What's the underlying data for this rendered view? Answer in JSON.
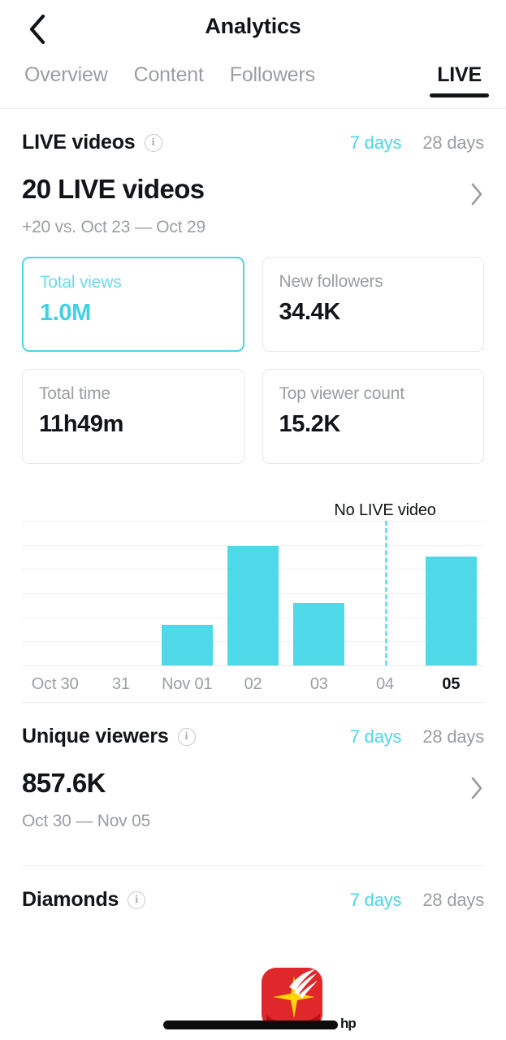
{
  "header": {
    "title": "Analytics",
    "back_icon": "chevron-left-icon"
  },
  "tabs": [
    {
      "label": "Overview",
      "active": false
    },
    {
      "label": "Content",
      "active": false
    },
    {
      "label": "Followers",
      "active": false
    },
    {
      "label": "LIVE",
      "active": true
    }
  ],
  "live_videos": {
    "title": "LIVE videos",
    "info_icon": "info-icon",
    "ranges": [
      {
        "label": "7 days",
        "active": true
      },
      {
        "label": "28 days",
        "active": false
      }
    ],
    "headline": "20 LIVE videos",
    "compare": "+20 vs. Oct 23 — Oct 29",
    "chevron_icon": "chevron-right-icon",
    "cards": [
      {
        "label": "Total views",
        "value": "1.0M",
        "selected": true
      },
      {
        "label": "New followers",
        "value": "34.4K",
        "selected": false
      },
      {
        "label": "Total time",
        "value": "11h49m",
        "selected": false
      },
      {
        "label": "Top viewer count",
        "value": "15.2K",
        "selected": false
      }
    ]
  },
  "unique_viewers": {
    "title": "Unique viewers",
    "info_icon": "info-icon",
    "ranges": [
      {
        "label": "7 days",
        "active": true
      },
      {
        "label": "28 days",
        "active": false
      }
    ],
    "headline": "857.6K",
    "compare": "Oct 30 — Nov 05",
    "chevron_icon": "chevron-right-icon"
  },
  "diamonds": {
    "title": "Diamonds",
    "info_icon": "info-icon",
    "ranges": [
      {
        "label": "7 days",
        "active": true
      },
      {
        "label": "28 days",
        "active": false
      }
    ]
  },
  "overlay": {
    "app_icon": "red-sparkle-app-icon",
    "watermark": "hp",
    "home_indicator": "home-indicator"
  },
  "colors": {
    "accent_cyan": "#4fd8e8",
    "bar": "#4fd8e8",
    "text_primary": "#111418",
    "text_muted": "#9a9ea3",
    "overlay_red": "#e0272b",
    "overlay_star": "#ffd400"
  },
  "chart_data": {
    "type": "bar",
    "title": "Total views",
    "xlabel": "",
    "ylabel": "",
    "grid": true,
    "gridlines": 6,
    "ylim": [
      0,
      300000
    ],
    "categories": [
      "Oct 30",
      "31",
      "Nov 01",
      "02",
      "03",
      "04",
      "05"
    ],
    "tick_labels": [
      "Oct 30",
      "31",
      "Nov 01",
      "02",
      "03",
      "04",
      "05"
    ],
    "emphasized_tick": "05",
    "values": [
      0,
      0,
      84000,
      248000,
      130000,
      0,
      225000
    ],
    "annotations": [
      {
        "text": "No LIVE video",
        "at_category": "04",
        "style": "dashed-vertical-line"
      }
    ]
  }
}
